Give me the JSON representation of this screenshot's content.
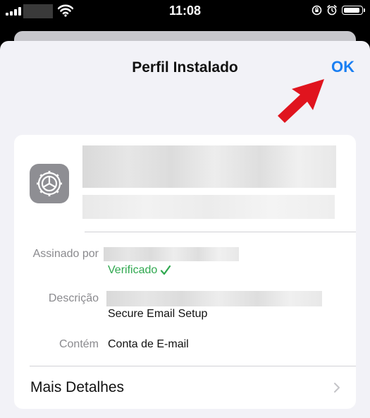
{
  "status_bar": {
    "time": "11:08",
    "icons": [
      "cellular-signal-icon",
      "wifi-icon",
      "orientation-lock-icon",
      "alarm-icon",
      "battery-icon"
    ]
  },
  "sheet": {
    "title": "Perfil Instalado",
    "ok_label": "OK"
  },
  "profile": {
    "icon": "settings-gear-icon",
    "details": [
      {
        "label": "Assinado por",
        "status": "Verificado"
      },
      {
        "label": "Descrição",
        "value": "Secure Email Setup"
      },
      {
        "label": "Contém",
        "value": "Conta de E-mail"
      }
    ],
    "more_details_label": "Mais Detalhes"
  },
  "colors": {
    "accent": "#1a7ff2",
    "verified": "#2fa84f",
    "annotation_arrow": "#e0141e"
  }
}
